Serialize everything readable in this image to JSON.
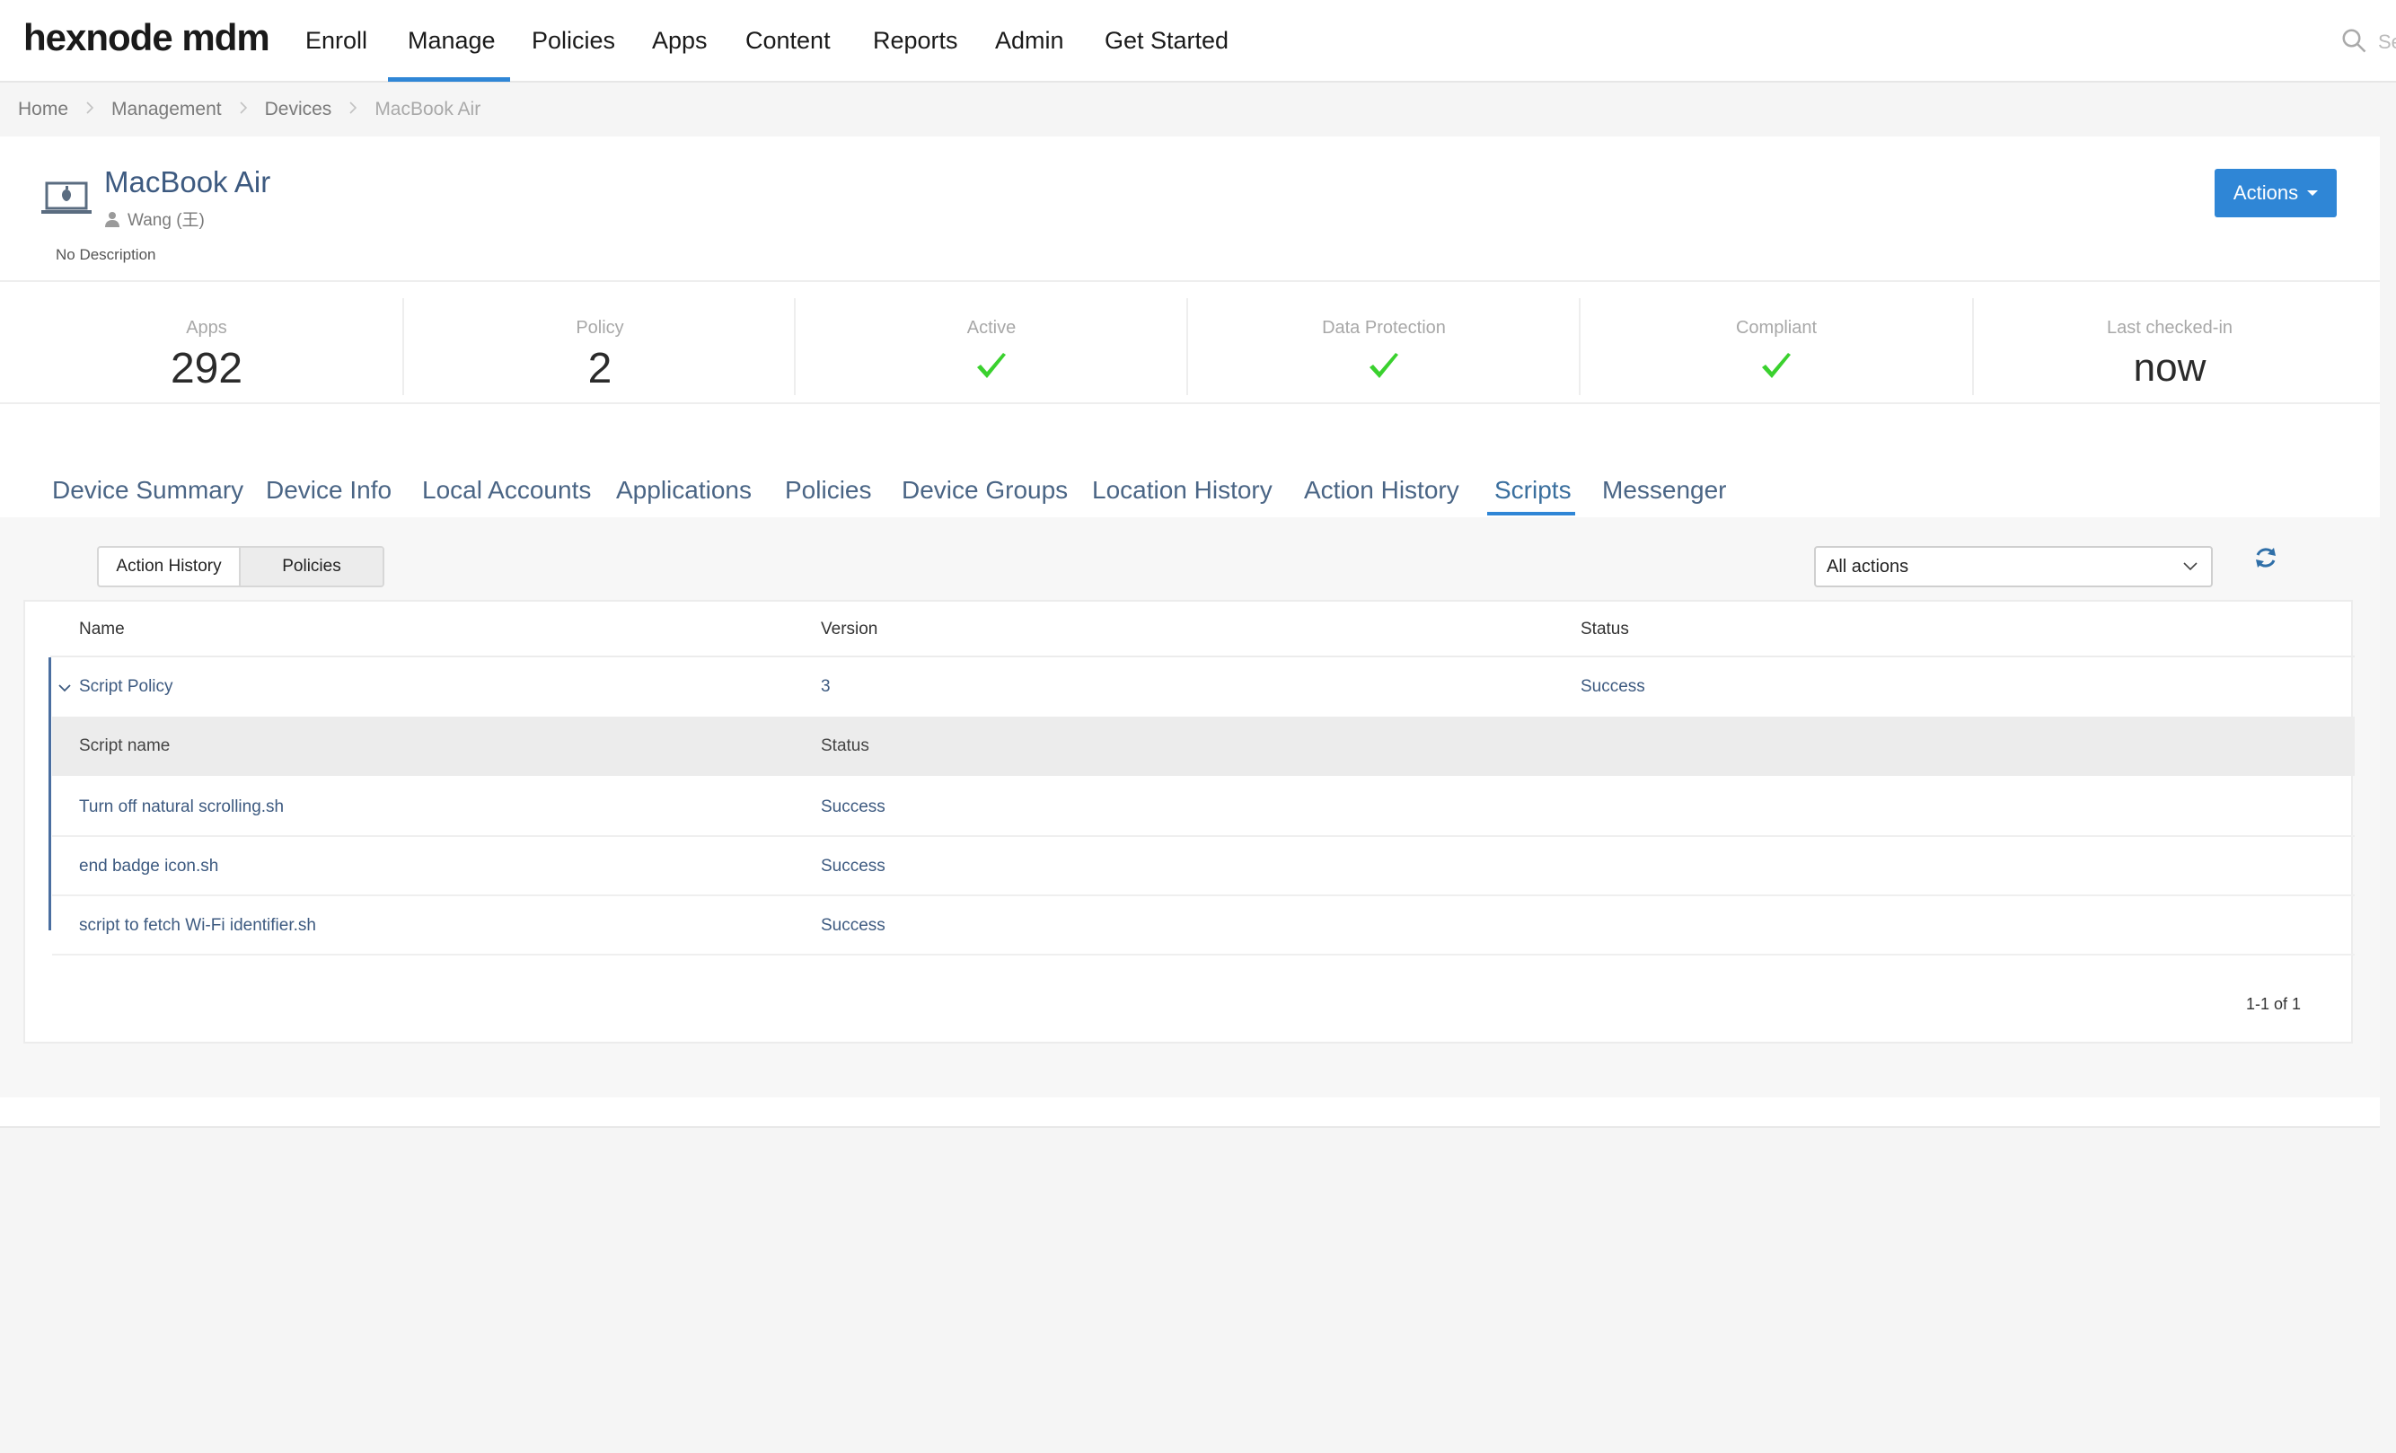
{
  "app": {
    "logo": "hexnode mdm",
    "nav": [
      "Enroll",
      "Manage",
      "Policies",
      "Apps",
      "Content",
      "Reports",
      "Admin",
      "Get Started"
    ],
    "active_nav": "Manage",
    "search_placeholder": "Se"
  },
  "breadcrumb": [
    "Home",
    "Management",
    "Devices",
    "MacBook Air"
  ],
  "device": {
    "name": "MacBook Air",
    "user": "Wang (王)",
    "description": "No Description",
    "actions_label": "Actions"
  },
  "stats": {
    "apps_label": "Apps",
    "apps_value": "292",
    "policy_label": "Policy",
    "policy_value": "2",
    "active_label": "Active",
    "data_protection_label": "Data Protection",
    "compliant_label": "Compliant",
    "last_checked_label": "Last checked-in",
    "last_checked_value": "now"
  },
  "tabs": [
    "Device Summary",
    "Device Info",
    "Local Accounts",
    "Applications",
    "Policies",
    "Device Groups",
    "Location History",
    "Action History",
    "Scripts",
    "Messenger"
  ],
  "active_tab": "Scripts",
  "toolbar": {
    "seg_action_history": "Action History",
    "seg_policies": "Policies",
    "filter_value": "All actions"
  },
  "table": {
    "headers": {
      "name": "Name",
      "version": "Version",
      "status": "Status"
    },
    "policy_row": {
      "name": "Script Policy",
      "version": "3",
      "status": "Success"
    },
    "sub_headers": {
      "script_name": "Script name",
      "status": "Status"
    },
    "scripts": [
      {
        "name": "Turn off natural scrolling.sh",
        "status": "Success"
      },
      {
        "name": "end badge icon.sh",
        "status": "Success"
      },
      {
        "name": "script to fetch Wi-Fi identifier.sh",
        "status": "Success"
      }
    ],
    "pagination": "1-1 of 1"
  },
  "colors": {
    "accent": "#2f86d6",
    "link": "#3d5a80",
    "check": "#3ad12e"
  }
}
